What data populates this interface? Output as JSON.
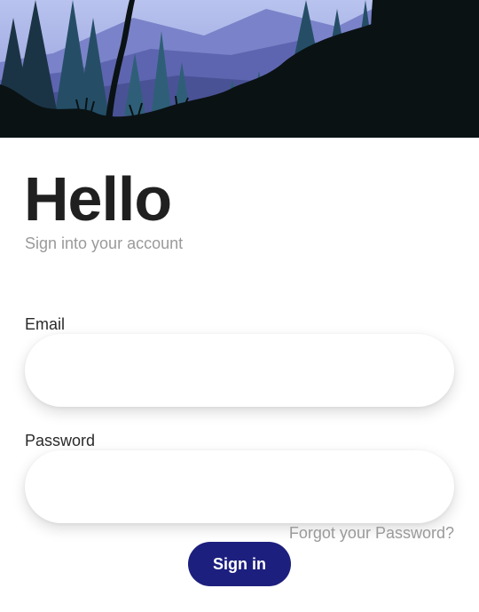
{
  "header": {
    "image_name": "forest-mountain-illustration"
  },
  "greeting": {
    "title": "Hello",
    "subtitle": "Sign into your account"
  },
  "form": {
    "email_label": "Email",
    "email_value": "",
    "password_label": "Password",
    "password_value": "",
    "forgot_label": "Forgot your Password?",
    "submit_label": "Sign in"
  },
  "colors": {
    "primary": "#1d1f7e",
    "title": "#202020",
    "muted": "#9a9a9a",
    "background": "#ffffff"
  }
}
